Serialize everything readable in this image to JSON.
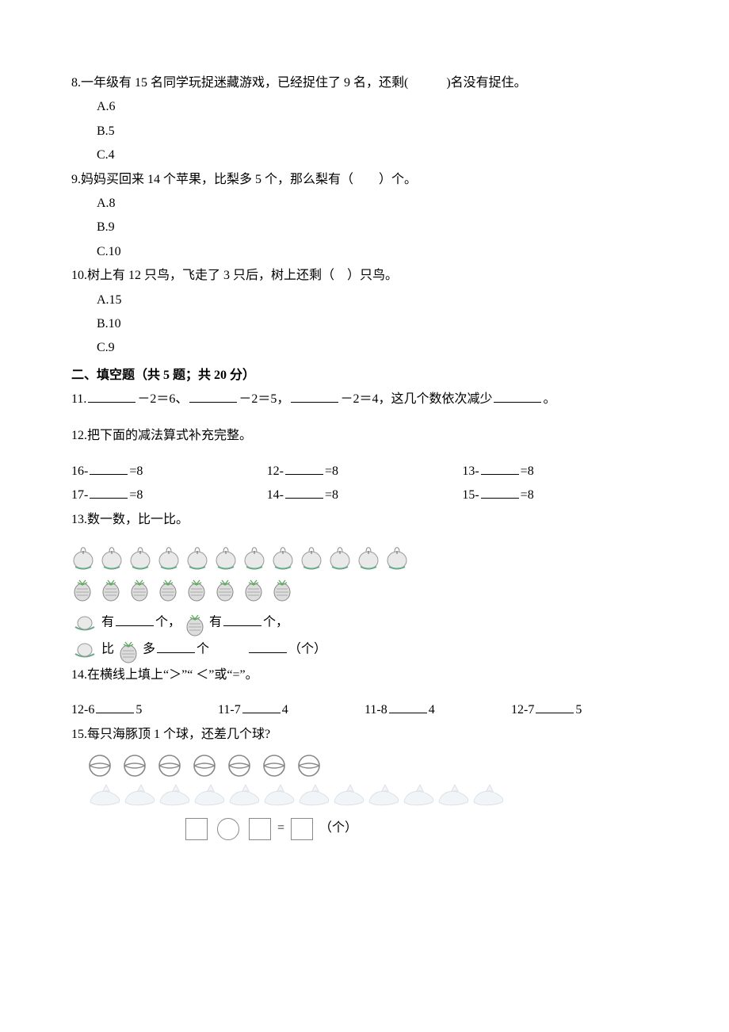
{
  "q8": {
    "text": "8.一年级有 15 名同学玩捉迷藏游戏，已经捉住了 9 名，还剩(　　　)名没有捉住。",
    "opts": [
      "A.6",
      "B.5",
      "C.4"
    ]
  },
  "q9": {
    "text": "9.妈妈买回来 14 个苹果，比梨多 5 个，那么梨有（　　）个。",
    "opts": [
      "A.8",
      "B.9",
      "C.10"
    ]
  },
  "q10": {
    "text": "10.树上有 12 只鸟，飞走了 3 只后，树上还剩（　）只鸟。",
    "opts": [
      "A.15",
      "B.10",
      "C.9"
    ]
  },
  "section2": "二、填空题（共 5 题；共 20 分）",
  "q11": {
    "p1": "11.",
    "seg1": "－2＝6、",
    "seg2": "－2＝5，",
    "seg3": "－2＝4，这几个数依次减少",
    "seg4": "。"
  },
  "q12": {
    "title": "12.把下面的减法算式补充完整。",
    "row1": {
      "a": "16-",
      "b": "12-",
      "c": "13-",
      "tail": "=8"
    },
    "row2": {
      "a": "17-",
      "b": "14-",
      "c": "15-",
      "tail": "=8"
    }
  },
  "q13": {
    "title": "13.数一数，比一比。",
    "apples": 12,
    "pineapples": 8,
    "line1a": "有",
    "line1b": "个，",
    "line1c": "有",
    "line1d": "个，",
    "line2a": "比",
    "line2b": "多",
    "line2c": "个",
    "line2d": "（个）"
  },
  "q14": {
    "title": "14.在横线上填上“＞”“ ＜”或“=”。",
    "items": [
      {
        "l": "12-6",
        "r": "5"
      },
      {
        "l": "11-7",
        "r": "4"
      },
      {
        "l": "11-8",
        "r": "4"
      },
      {
        "l": "12-7",
        "r": "5"
      }
    ]
  },
  "q15": {
    "title": "15.每只海豚顶 1 个球，还差几个球?",
    "balls": 7,
    "dolphins": 12,
    "eqtail": "（个）"
  }
}
